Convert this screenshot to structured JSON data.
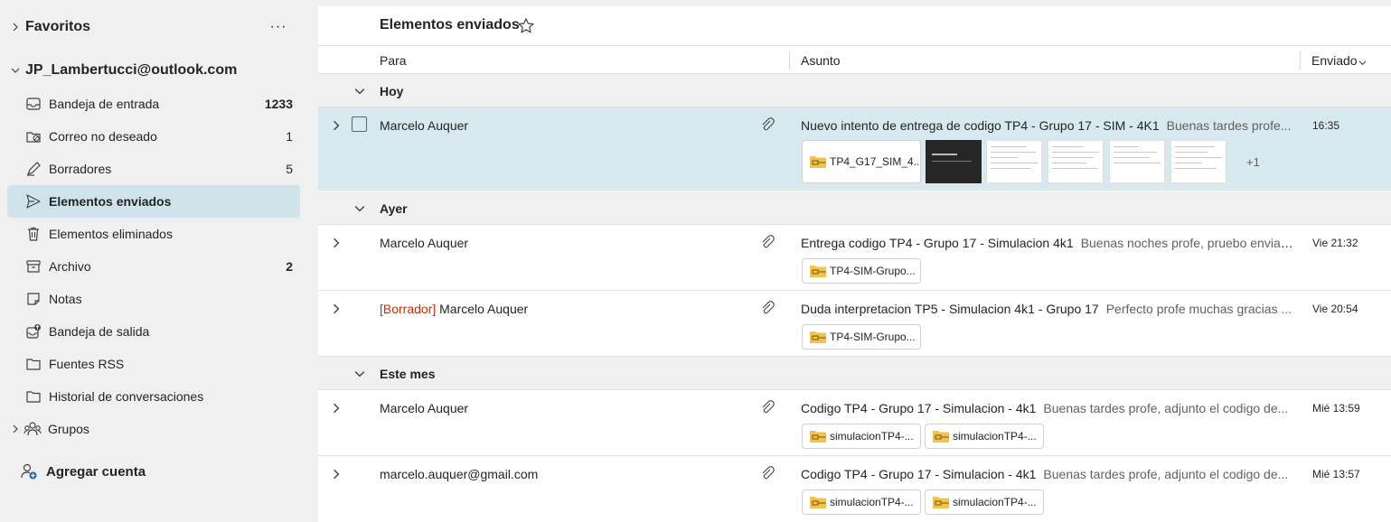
{
  "sidebar": {
    "favorites_label": "Favoritos",
    "more_label": "···",
    "account_label": "JP_Lambertucci@outlook.com",
    "folders": [
      {
        "label": "Bandeja de entrada",
        "count": "1233",
        "icon": "inbox-icon"
      },
      {
        "label": "Correo no deseado",
        "count": "1",
        "icon": "junk-icon"
      },
      {
        "label": "Borradores",
        "count": "5",
        "icon": "drafts-icon"
      },
      {
        "label": "Elementos enviados",
        "count": "",
        "icon": "sent-icon"
      },
      {
        "label": "Elementos eliminados",
        "count": "",
        "icon": "trash-icon"
      },
      {
        "label": "Archivo",
        "count": "2",
        "icon": "archive-icon"
      },
      {
        "label": "Notas",
        "count": "",
        "icon": "notes-icon"
      },
      {
        "label": "Bandeja de salida",
        "count": "",
        "icon": "outbox-icon"
      },
      {
        "label": "Fuentes RSS",
        "count": "",
        "icon": "folder-icon"
      },
      {
        "label": "Historial de conversaciones",
        "count": "",
        "icon": "folder-icon"
      }
    ],
    "groups_label": "Grupos",
    "add_account_label": "Agregar cuenta"
  },
  "list": {
    "title": "Elementos enviados",
    "columns": {
      "to": "Para",
      "subject": "Asunto",
      "sent": "Enviado"
    },
    "groups": [
      {
        "label": "Hoy",
        "messages": [
          {
            "sender": "Marcelo Auquer",
            "subject": "Nuevo intento de entrega de codigo TP4 - Grupo 17 - SIM - 4K1",
            "preview": "Buenas tardes profe...",
            "time": "16:35",
            "attachments": [
              "TP4_G17_SIM_4..."
            ],
            "more_attachments": "+1"
          }
        ]
      },
      {
        "label": "Ayer",
        "messages": [
          {
            "sender": "Marcelo Auquer",
            "subject": "Entrega codigo TP4 - Grupo 17 - Simulacion 4k1",
            "preview": "Buenas noches profe, pruebo enviar...",
            "time": "Vie 21:32",
            "attachments": [
              "TP4-SIM-Grupo..."
            ]
          },
          {
            "draft_tag": "[Borrador]",
            "sender": "Marcelo Auquer",
            "subject": "Duda interpretacion TP5 - Simulacion 4k1 - Grupo 17",
            "preview": "Perfecto profe muchas gracias ...",
            "time": "Vie 20:54",
            "attachments": [
              "TP4-SIM-Grupo..."
            ]
          }
        ]
      },
      {
        "label": "Este mes",
        "messages": [
          {
            "sender": "Marcelo Auquer",
            "subject": "Codigo TP4 - Grupo 17 - Simulacion - 4k1",
            "preview": "Buenas tardes profe, adjunto el codigo de...",
            "time": "Mié 13:59",
            "attachments": [
              "simulacionTP4-...",
              "simulacionTP4-..."
            ]
          },
          {
            "sender": "marcelo.auquer@gmail.com",
            "subject": "Codigo TP4 - Grupo 17 - Simulacion - 4k1",
            "preview": "Buenas tardes profe, adjunto el codigo de...",
            "time": "Mié 13:57",
            "attachments": [
              "simulacionTP4-...",
              "simulacionTP4-..."
            ]
          }
        ]
      }
    ]
  },
  "colors": {
    "selected_row": "#d7e9ef",
    "active_folder": "#cfe4ea",
    "draft_tag": "#c4320a",
    "zip_icon": "#f2c14e"
  }
}
